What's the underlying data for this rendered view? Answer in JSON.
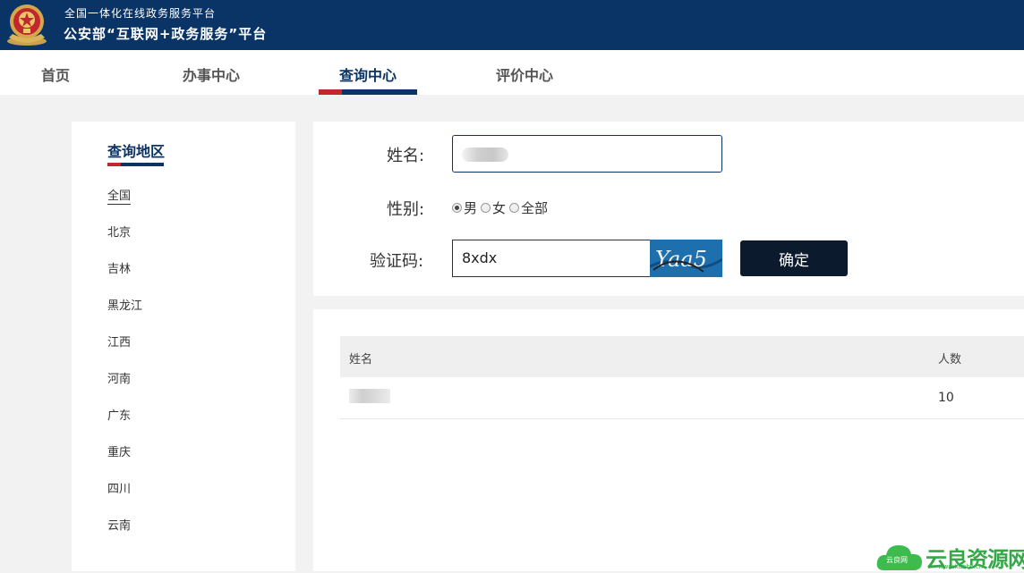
{
  "header": {
    "subtitle": "全国一体化在线政务服务平台",
    "title": "公安部“互联网+政务服务”平台",
    "bg_color": "#0b3466"
  },
  "nav": {
    "items": [
      "首页",
      "办事中心",
      "查询中心",
      "评价中心"
    ],
    "active": "查询中心",
    "accent_red": "#c1272d"
  },
  "sidebar": {
    "title": "查询地区",
    "regions": [
      "全国",
      "北京",
      "吉林",
      "黑龙江",
      "江西",
      "河南",
      "广东",
      "重庆",
      "四川",
      "云南"
    ],
    "active": "全国"
  },
  "form": {
    "name_label": "姓名:",
    "gender_label": "性别:",
    "gender_options": [
      "男",
      "女",
      "全部"
    ],
    "gender_selected": "男",
    "captcha_label": "验证码:",
    "captcha_value": "8xdx",
    "captcha_image_text": "Yaa5",
    "confirm_label": "确定"
  },
  "results": {
    "columns": [
      "姓名",
      "人数"
    ],
    "rows": [
      {
        "count": "10"
      }
    ]
  },
  "watermark": {
    "text": "云良资源网",
    "url": "www.kubbs.cn",
    "small": "云良网"
  }
}
